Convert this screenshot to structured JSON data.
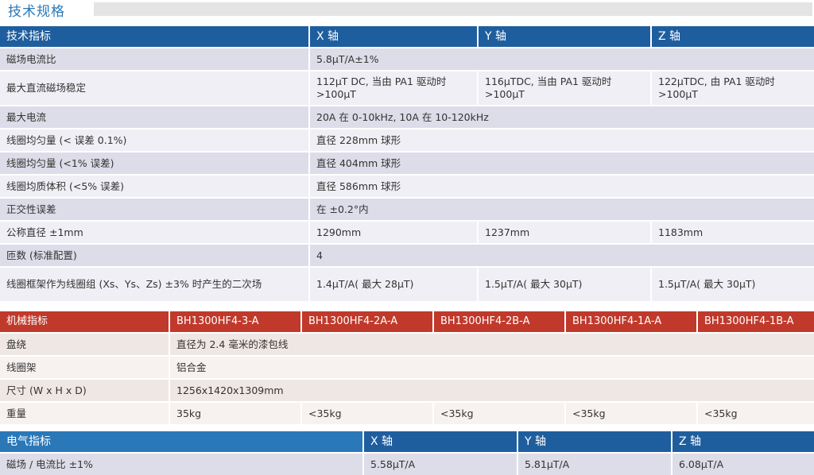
{
  "header": {
    "title": "技术规格"
  },
  "spec": {
    "cols": [
      "技术指标",
      "X 轴",
      "Y 轴",
      "Z 轴"
    ],
    "rows": [
      {
        "label": "磁场电流比",
        "span": "5.8μT/A±1%"
      },
      {
        "label": "最大直流磁场稳定",
        "x": "112μT DC, 当由 PA1 驱动时 >100μT",
        "y": "116μTDC, 当由 PA1 驱动时 >100μT",
        "z": "122μTDC, 由 PA1 驱动时 >100μT"
      },
      {
        "label": "最大电流",
        "span": "20A 在 0-10kHz,  10A 在 10-120kHz"
      },
      {
        "label": "线圈均匀量 (< 误差 0.1%)",
        "span": "直径 228mm 球形"
      },
      {
        "label": "线圈均匀量 (<1% 误差)",
        "span": "直径 404mm 球形"
      },
      {
        "label": "线圈均质体积  (<5% 误差)",
        "span": "直径 586mm 球形"
      },
      {
        "label": "正交性误差",
        "span": "在 ±0.2°内"
      },
      {
        "label": "公称直径 ±1mm",
        "x": "1290mm",
        "y": "1237mm",
        "z": "1183mm"
      },
      {
        "label": "匝数 (标准配置)",
        "span": "4"
      },
      {
        "label": "线圈框架作为线圈组 (Xs、Ys、Zs) ±3% 时产生的二次场",
        "x": "1.4μT/A( 最大 28μT)",
        "y": "1.5μT/A( 最大 30μT)",
        "z": "1.5μT/A( 最大 30μT)"
      }
    ]
  },
  "mech": {
    "cols": [
      "机械指标",
      "BH1300HF4-3-A",
      "BH1300HF4-2A-A",
      "BH1300HF4-2B-A",
      "BH1300HF4-1A-A",
      "BH1300HF4-1B-A"
    ],
    "rows": [
      {
        "label": "盘绕",
        "span": "直径为 2.4 毫米的漆包线"
      },
      {
        "label": "线圈架",
        "span": "铝合金"
      },
      {
        "label": "尺寸 (W x H x D)",
        "span": "1256x1420x1309mm"
      },
      {
        "label": "重量",
        "vals": [
          "35kg",
          "<35kg",
          "<35kg",
          "<35kg",
          "<35kg"
        ]
      }
    ]
  },
  "elec": {
    "cols": [
      "电气指标",
      "X 轴",
      "Y 轴",
      "Z 轴"
    ],
    "rows": [
      {
        "label": "磁场 / 电流比 ±1%",
        "vals": [
          "5.58μT/A",
          "5.81μT/A",
          "6.08μT/A"
        ]
      }
    ]
  }
}
